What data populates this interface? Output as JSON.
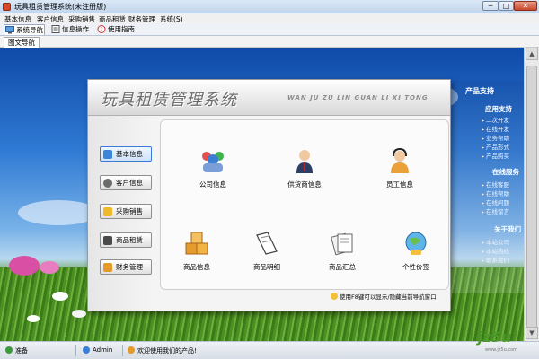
{
  "window": {
    "title": "玩具租赁管理系统(未注册版)",
    "min": "─",
    "max": "□",
    "close": "✕"
  },
  "menu": [
    "基本信息",
    "客户信息",
    "采购销售",
    "商品租赁",
    "财务管理",
    "系统(S)"
  ],
  "toolbar_tabs": [
    {
      "label": "系统导航",
      "icon": "monitor-icon"
    },
    {
      "label": "信息操作",
      "icon": "document-icon"
    },
    {
      "label": "使用指南",
      "icon": "help-icon"
    }
  ],
  "doc_tab": "图文导航",
  "panel": {
    "title": "玩具租赁管理系统",
    "pinyin": "WAN JU ZU LIN GUAN LI XI TONG",
    "nav": [
      {
        "label": "基本信息",
        "icon": "monitor-icon"
      },
      {
        "label": "客户信息",
        "icon": "person-icon"
      },
      {
        "label": "采购销售",
        "icon": "star-icon"
      },
      {
        "label": "商品租赁",
        "icon": "user-card-icon"
      },
      {
        "label": "财务管理",
        "icon": "money-icon"
      }
    ],
    "grid": [
      {
        "label": "公司信息",
        "icon": "group-icon"
      },
      {
        "label": "供货商信息",
        "icon": "businessman-icon"
      },
      {
        "label": "员工信息",
        "icon": "headset-icon"
      },
      {
        "label": "商品信息",
        "icon": "boxes-icon"
      },
      {
        "label": "商品明细",
        "icon": "notebook-icon"
      },
      {
        "label": "商品汇总",
        "icon": "documents-icon"
      },
      {
        "label": "个性价签",
        "icon": "globe-icon"
      }
    ],
    "footer_hint": "使用F8键可以显示/隐藏当前导航窗口"
  },
  "right_panel": {
    "product_support": "产品支持",
    "app_support": "应用支持",
    "app_links": [
      "二次开发",
      "在线开发",
      "业务帮助",
      "产品形式",
      "产品购买"
    ],
    "online_service": "在线服务",
    "service_links": [
      "在线客服",
      "在线帮助",
      "在线问题",
      "在线留言"
    ],
    "about": "关于我们",
    "about_links": [
      "本站公司",
      "本站热线",
      "联系我们"
    ]
  },
  "status": {
    "ready": "准备",
    "user": "Admin",
    "welcome": "欢迎使用我们的产品!"
  },
  "watermark": {
    "logo": "jz5u",
    "sub": "www.jz5u.com"
  }
}
